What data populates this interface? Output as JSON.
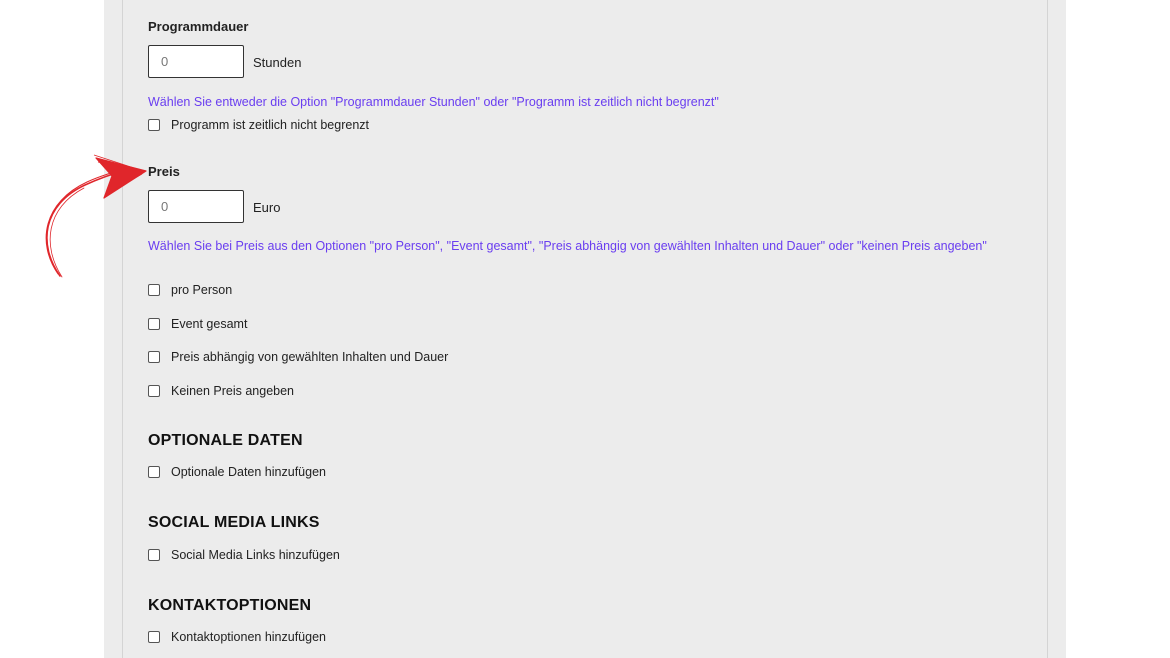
{
  "programmdauer": {
    "label": "Programmdauer",
    "value": "0",
    "unit": "Stunden",
    "hint": "Wählen Sie entweder die Option \"Programmdauer Stunden\" oder \"Programm ist zeitlich nicht begrenzt\"",
    "checkbox_label": "Programm ist zeitlich nicht begrenzt"
  },
  "preis": {
    "label": "Preis",
    "value": "0",
    "unit": "Euro",
    "hint": "Wählen Sie bei Preis aus den Optionen \"pro Person\", \"Event gesamt\", \"Preis abhängig von gewählten Inhalten und Dauer\" oder \"keinen Preis angeben\"",
    "options": [
      {
        "label": "pro Person",
        "checked": false
      },
      {
        "label": "Event gesamt",
        "checked": false
      },
      {
        "label": "Preis abhängig von gewählten Inhalten und Dauer",
        "checked": false
      },
      {
        "label": "Keinen Preis angeben",
        "checked": false
      }
    ]
  },
  "optionale_daten": {
    "heading": "OPTIONALE DATEN",
    "checkbox_label": "Optionale Daten hinzufügen"
  },
  "social_media": {
    "heading": "SOCIAL MEDIA LINKS",
    "checkbox_label": "Social Media Links hinzufügen"
  },
  "kontakt": {
    "heading": "KONTAKTOPTIONEN",
    "checkbox_label": "Kontaktoptionen hinzufügen"
  },
  "colors": {
    "hint": "#6a3ef0",
    "arrow": "#e0262b",
    "panel": "#ececec"
  },
  "annotation": {
    "icon": "hand-drawn-arrow-icon"
  }
}
